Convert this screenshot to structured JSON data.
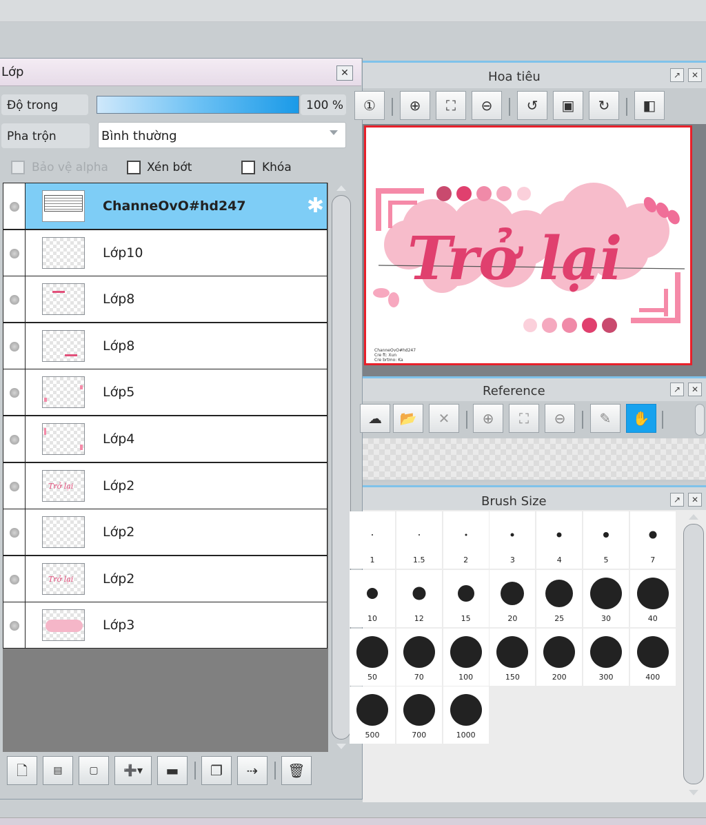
{
  "layer_panel": {
    "title": "Lớp",
    "close_icon": "✕",
    "opacity_label": "Độ trong",
    "opacity_value": "100 %",
    "opacity_level": 1.0,
    "blend_label": "Pha trộn",
    "blend_value": "Bình thường",
    "protect_alpha_label": "Bảo vệ alpha",
    "clip_label": "Xén bớt",
    "lock_label": "Khóa",
    "layers": [
      {
        "name": "ChanneOvO#hd247",
        "selected": true,
        "thumb": "credit"
      },
      {
        "name": "Lớp10",
        "selected": false,
        "thumb": "empty"
      },
      {
        "name": "Lớp8",
        "selected": false,
        "thumb": "dots-top"
      },
      {
        "name": "Lớp8",
        "selected": false,
        "thumb": "dots-bottom"
      },
      {
        "name": "Lớp5",
        "selected": false,
        "thumb": "frame"
      },
      {
        "name": "Lớp4",
        "selected": false,
        "thumb": "frame2"
      },
      {
        "name": "Lớp2",
        "selected": false,
        "thumb": "text"
      },
      {
        "name": "Lớp2",
        "selected": false,
        "thumb": "empty"
      },
      {
        "name": "Lớp2",
        "selected": false,
        "thumb": "text"
      },
      {
        "name": "Lớp3",
        "selected": false,
        "thumb": "blob"
      }
    ],
    "toolbar_icons": [
      "new-layer-icon",
      "new-8bit-layer-icon",
      "new-1bit-layer-icon",
      "new-layer-menu-icon",
      "new-folder-icon",
      "duplicate-layer-icon",
      "merge-down-icon",
      "delete-layer-icon"
    ]
  },
  "navigator": {
    "title": "Hoa tiêu",
    "canvas_text": "Trở lại",
    "credit_lines": [
      "ChanneOvO#hd247",
      "Cre ft: Xun",
      "Cre brtmo: Ka"
    ],
    "colors": {
      "frame": "#e8202a",
      "pink": "#f58aa8",
      "blob": "#f7bccb",
      "text": "#e0406e"
    }
  },
  "reference": {
    "title": "Reference"
  },
  "brush_size": {
    "title": "Brush Size",
    "sizes": [
      "1",
      "1.5",
      "2",
      "3",
      "4",
      "5",
      "7",
      "10",
      "12",
      "15",
      "20",
      "25",
      "30",
      "40",
      "50",
      "70",
      "100",
      "150",
      "200",
      "300",
      "400",
      "500",
      "700",
      "1000"
    ],
    "dots": [
      2,
      2,
      3,
      5,
      7,
      8,
      11,
      16,
      19,
      24,
      34,
      40,
      46,
      46,
      46,
      46,
      46,
      46,
      46,
      46,
      46,
      46,
      46,
      46
    ]
  },
  "selected_accent": "#7ecdf6"
}
